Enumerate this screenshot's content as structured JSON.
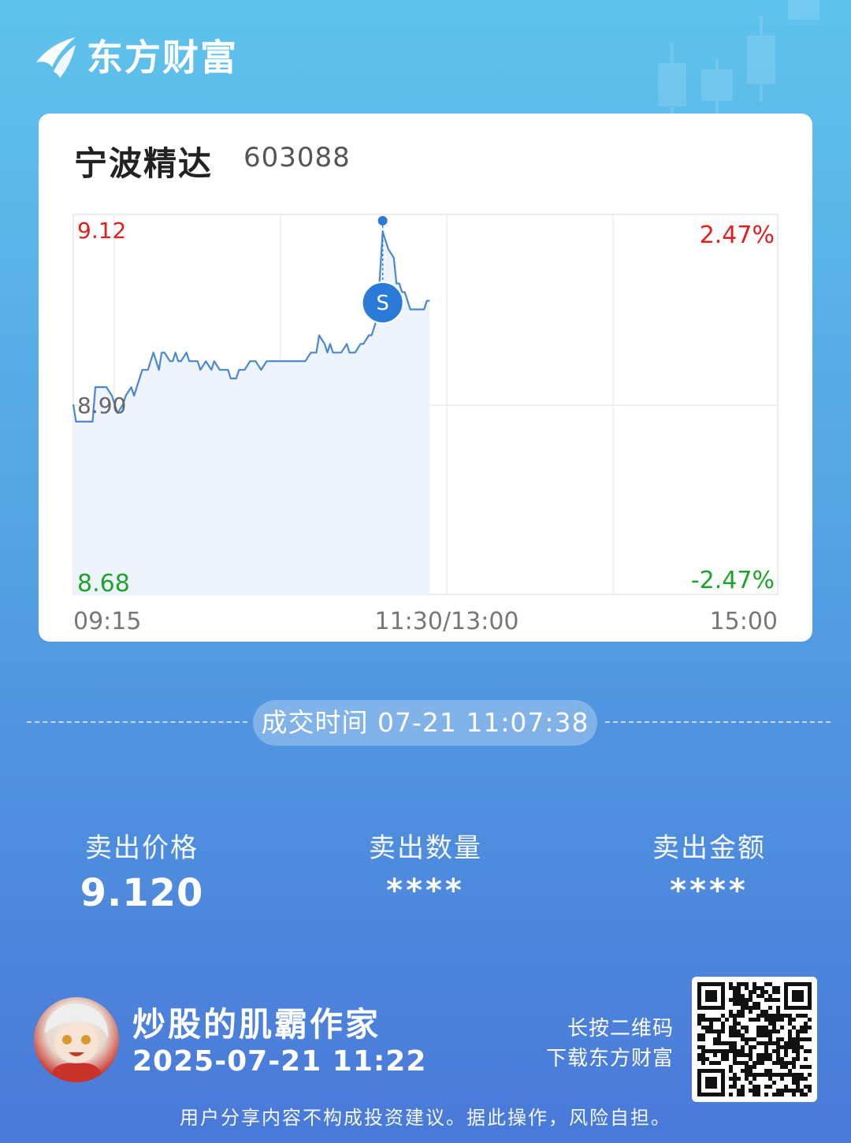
{
  "brand": {
    "name": "东方财富",
    "logo_icon": "eastmoney-logo-icon"
  },
  "stock": {
    "name": "宁波精达",
    "code": "603088"
  },
  "chart_data": {
    "type": "line",
    "title": "",
    "price_labels": {
      "high": "9.12",
      "mid": "8.90",
      "low": "8.68"
    },
    "pct_labels": {
      "high": "2.47%",
      "low": "-2.47%"
    },
    "ylim": [
      8.68,
      9.12
    ],
    "reference_price": 8.9,
    "time_labels": [
      "09:15",
      "11:30/13:00",
      "15:00"
    ],
    "x_unit": "minutes since 09:15 (session axis: 09:15–09:30 auction, 09:30–11:30, 13:00–15:00)",
    "x": [
      0,
      1,
      3,
      7,
      8,
      11,
      12,
      14,
      15,
      16,
      18,
      19,
      21,
      22,
      24,
      25,
      27,
      28,
      29,
      30,
      31,
      32,
      33,
      35,
      36,
      37,
      38,
      39,
      41,
      42,
      43,
      45,
      46,
      48,
      50,
      51,
      53,
      55,
      56,
      57,
      59,
      60,
      62,
      64,
      66,
      68,
      70,
      72,
      74,
      76,
      78,
      80,
      82,
      84,
      86,
      88,
      89,
      91,
      92,
      93,
      94,
      96,
      97,
      99,
      100,
      102,
      104,
      105,
      107,
      108,
      109,
      110,
      111,
      112,
      114,
      116,
      117,
      118,
      119,
      120,
      122,
      124,
      125,
      126,
      127,
      128,
      129
    ],
    "series": [
      {
        "values": [
          8.9,
          8.88,
          8.88,
          8.88,
          8.92,
          8.92,
          8.92,
          8.91,
          8.9,
          8.89,
          8.9,
          8.91,
          8.92,
          8.91,
          8.93,
          8.94,
          8.94,
          8.95,
          8.96,
          8.95,
          8.94,
          8.96,
          8.96,
          8.95,
          8.95,
          8.96,
          8.95,
          8.95,
          8.96,
          8.95,
          8.95,
          8.95,
          8.94,
          8.95,
          8.94,
          8.95,
          8.94,
          8.94,
          8.94,
          8.93,
          8.93,
          8.94,
          8.94,
          8.95,
          8.95,
          8.94,
          8.95,
          8.95,
          8.95,
          8.95,
          8.95,
          8.95,
          8.95,
          8.95,
          8.96,
          8.96,
          8.98,
          8.97,
          8.96,
          8.97,
          8.96,
          8.96,
          8.96,
          8.97,
          8.96,
          8.96,
          8.97,
          8.97,
          8.98,
          8.98,
          8.99,
          9.0,
          9.05,
          9.1,
          9.08,
          9.07,
          9.04,
          9.04,
          9.03,
          9.03,
          9.01,
          9.01,
          9.01,
          9.01,
          9.01,
          9.02,
          9.02
        ]
      }
    ],
    "sell_marker": {
      "label": "S",
      "x": 112,
      "price": 9.12,
      "color": "#2a7ad8"
    },
    "colors": {
      "line": "#4a86d4",
      "fill": "#eef4fc",
      "up": "#e02020",
      "down": "#1ea32a",
      "neutral": "#666666",
      "grid": "#e6e6e6"
    }
  },
  "trade_time": "成交时间 07-21 11:07:38",
  "stats": {
    "price": {
      "label": "卖出价格",
      "value": "9.120"
    },
    "qty": {
      "label": "卖出数量",
      "value": "****"
    },
    "amount": {
      "label": "卖出金额",
      "value": "****"
    }
  },
  "user": {
    "name": "炒股的肌霸作家",
    "time": "2025-07-21 11:22",
    "avatar_icon": "avatar-icon"
  },
  "qr": {
    "hint_line1": "长按二维码",
    "hint_line2": "下载东方财富",
    "icon": "qr-code-icon"
  },
  "disclaimer": "用户分享内容不构成投资建议。据此操作，风险自担。"
}
